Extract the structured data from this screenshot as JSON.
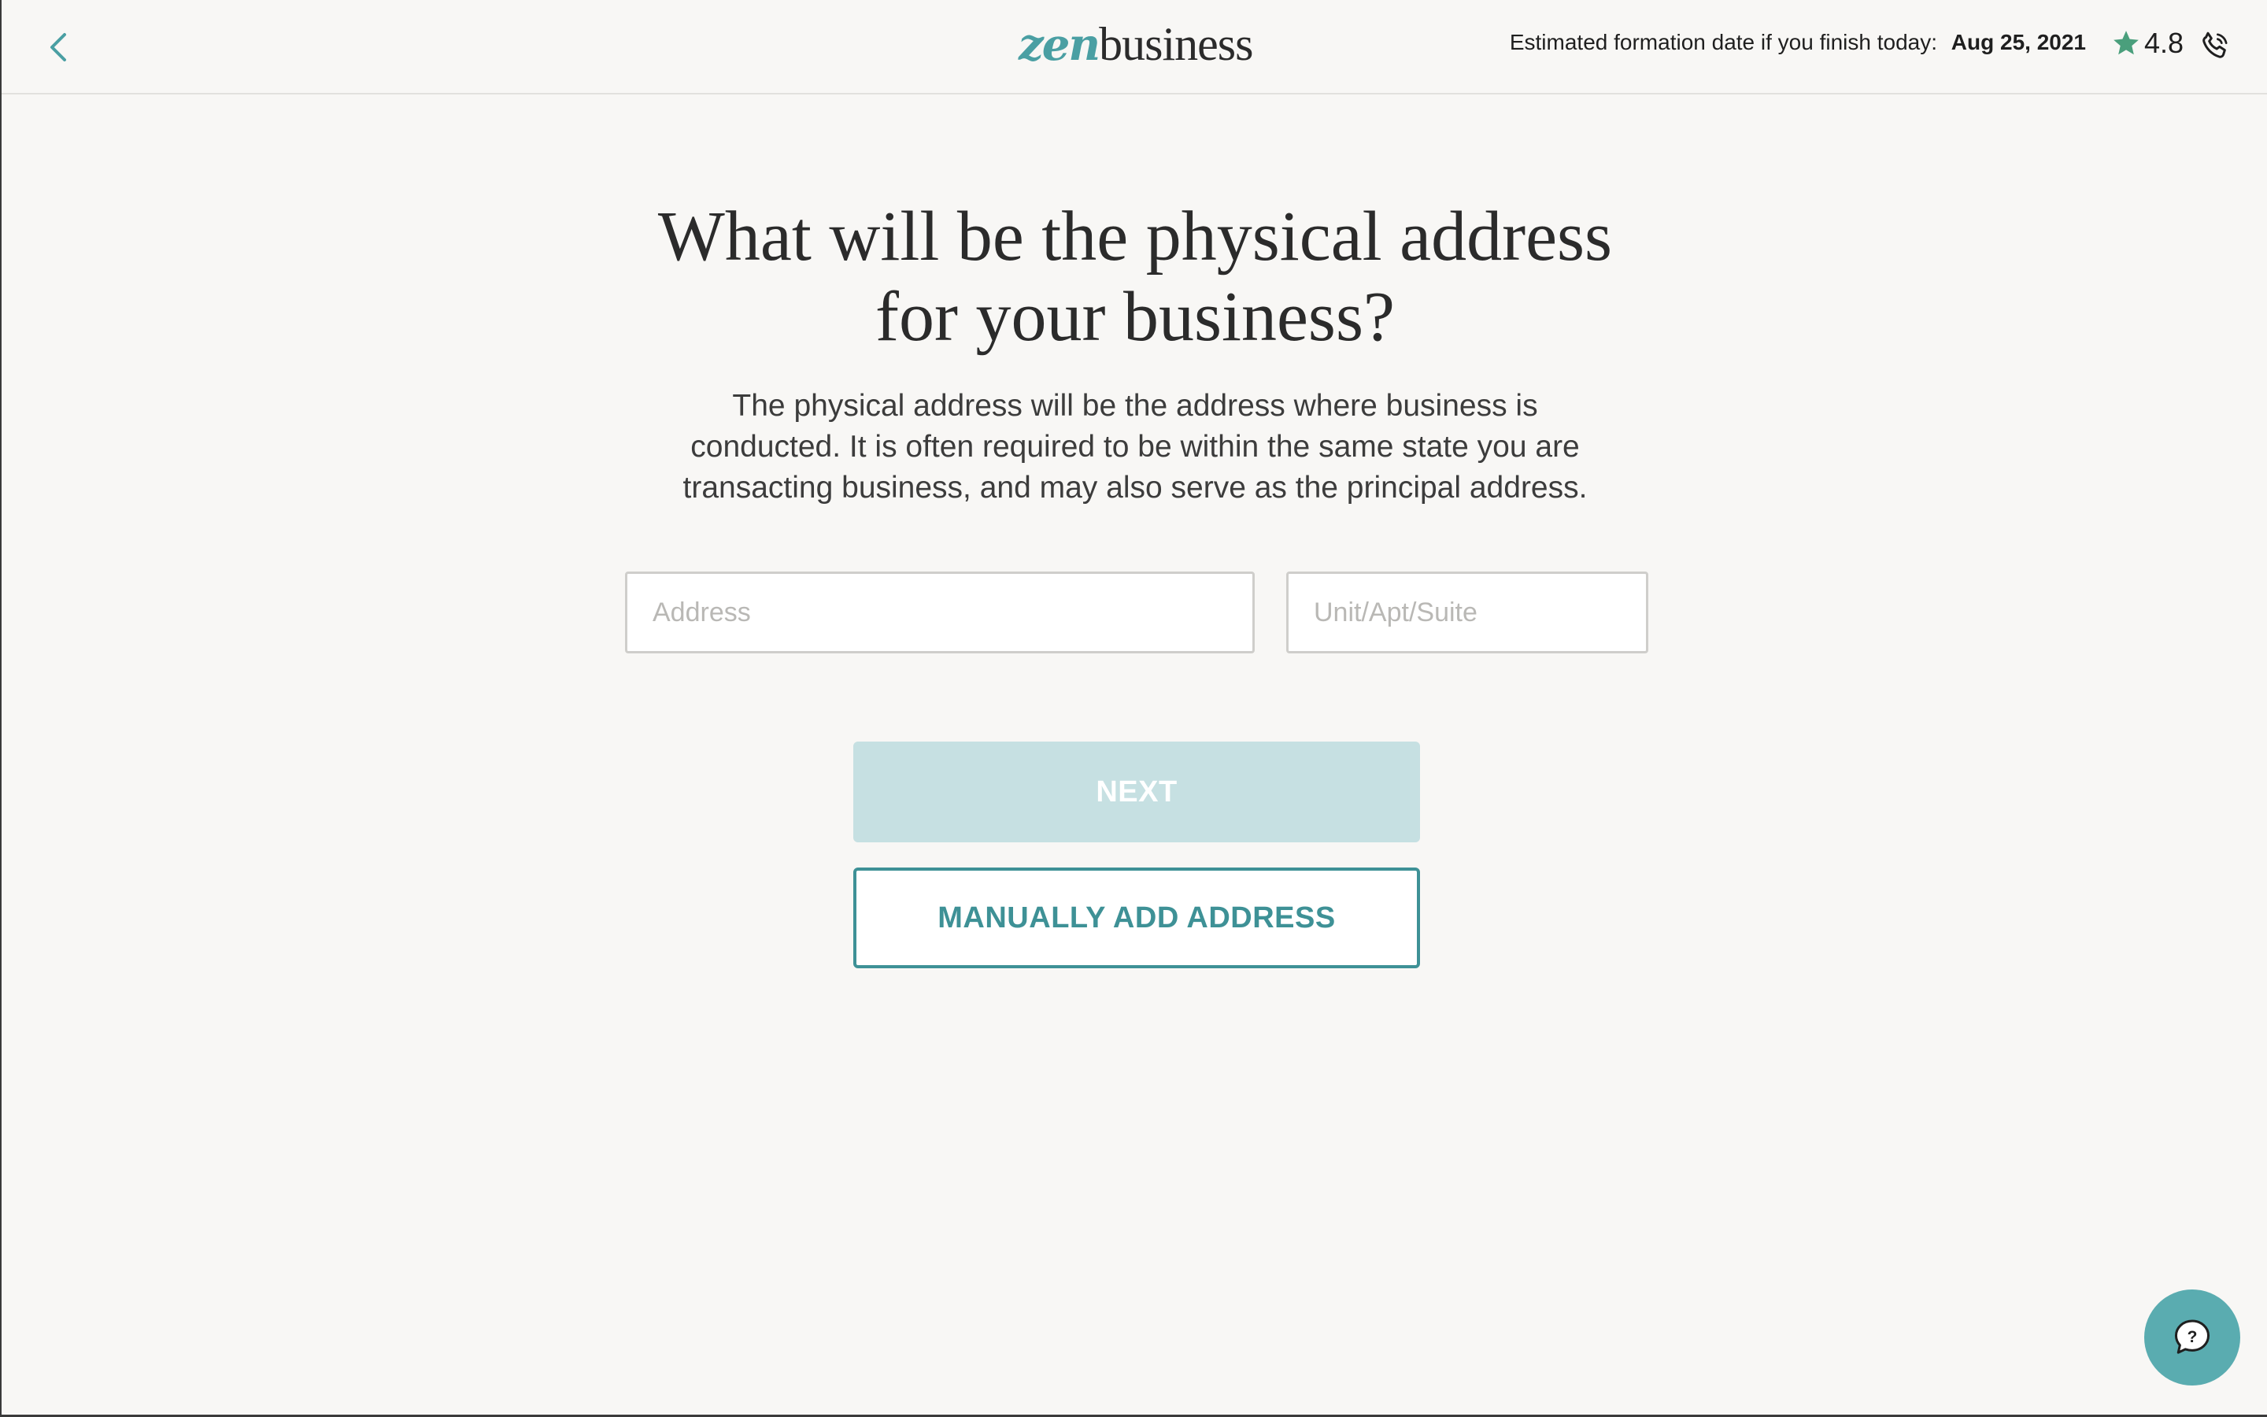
{
  "header": {
    "logo_zen": "zen",
    "logo_business": "business",
    "formation_label": "Estimated formation date if you finish today:",
    "formation_date": "Aug 25, 2021",
    "rating": "4.8",
    "back_icon": "chevron-left-icon",
    "star_icon": "star-icon",
    "phone_icon": "phone-icon"
  },
  "main": {
    "title_line1": "What will be the physical address",
    "title_line2": "for your business?",
    "description": "The physical address will be the address where business is conducted. It is often required to be within the same state you are transacting business, and may also serve as the principal address.",
    "address_placeholder": "Address",
    "address_value": "",
    "unit_placeholder": "Unit/Apt/Suite",
    "unit_value": "",
    "next_label": "NEXT",
    "manual_label": "MANUALLY ADD ADDRESS"
  },
  "help": {
    "icon": "help-chat-icon",
    "glyph": "?"
  },
  "colors": {
    "accent": "#3e9196",
    "accent_light": "#c6e0e2",
    "star": "#4a9f7c",
    "background": "#f8f7f5"
  }
}
